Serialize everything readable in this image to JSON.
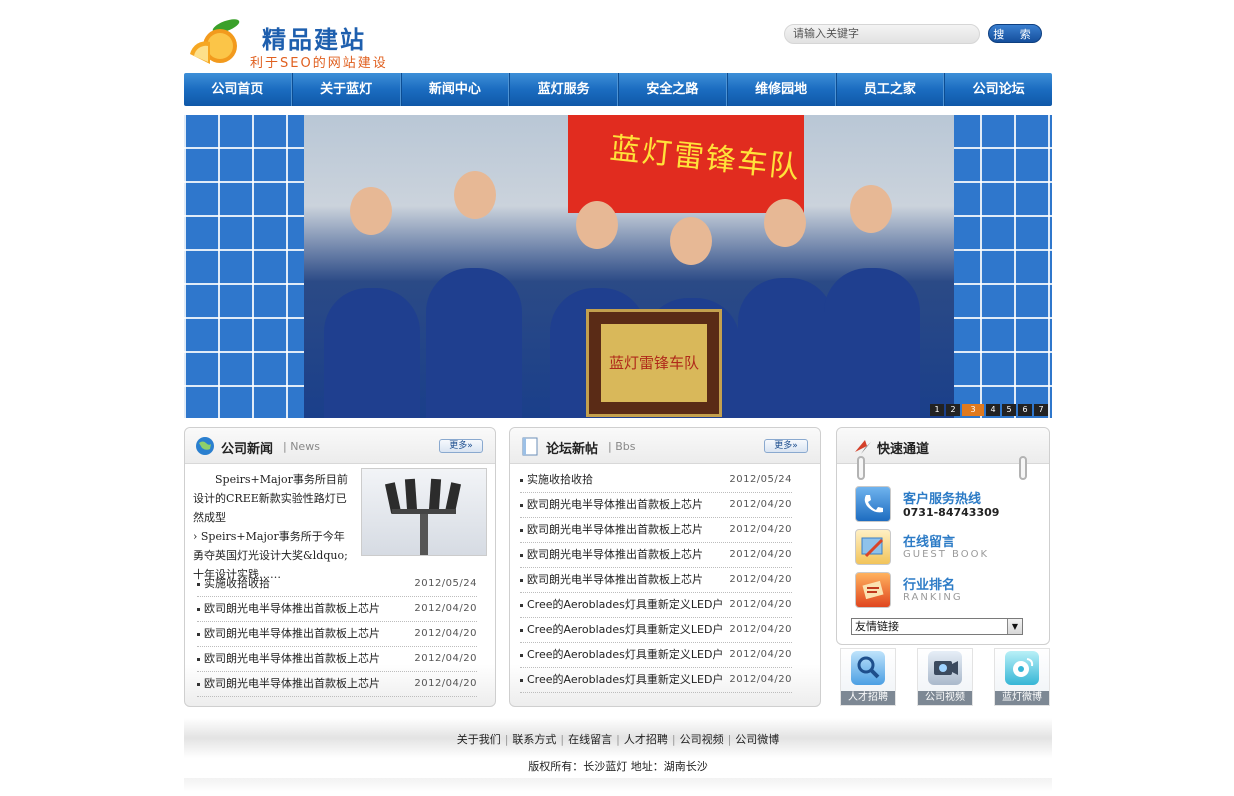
{
  "header": {
    "logo_title": "精品建站",
    "logo_subtitle": "利于SEO的网站建设",
    "search_placeholder": "请输入关键字",
    "search_button": "搜 索"
  },
  "nav": [
    "公司首页",
    "关于蓝灯",
    "新闻中心",
    "蓝灯服务",
    "安全之路",
    "维修园地",
    "员工之家",
    "公司论坛"
  ],
  "banner": {
    "flag_text": "蓝灯雷锋车队",
    "plaque_text": "蓝灯雷锋车队",
    "pages": [
      "1",
      "2",
      "3",
      "4",
      "5",
      "6",
      "7"
    ],
    "active_page": "3"
  },
  "news": {
    "title": "公司新闻",
    "subtitle": "| News",
    "more": "更多»",
    "intro_line1": "Speirs+Major事务所目前设计的CREE新款实验性路灯已然成型",
    "intro_line2": "› Speirs+Major事务所于今年勇夺英国灯光设计大奖&ldquo;十年设计实践……",
    "items": [
      {
        "title": "实施收拾收拾",
        "date": "2012/05/24"
      },
      {
        "title": "欧司朗光电半导体推出首款板上芯片",
        "date": "2012/04/20"
      },
      {
        "title": "欧司朗光电半导体推出首款板上芯片",
        "date": "2012/04/20"
      },
      {
        "title": "欧司朗光电半导体推出首款板上芯片",
        "date": "2012/04/20"
      },
      {
        "title": "欧司朗光电半导体推出首款板上芯片",
        "date": "2012/04/20"
      }
    ]
  },
  "bbs": {
    "title": "论坛新帖",
    "subtitle": "| Bbs",
    "more": "更多»",
    "items": [
      {
        "title": "实施收拾收拾",
        "date": "2012/05/24"
      },
      {
        "title": "欧司朗光电半导体推出首款板上芯片",
        "date": "2012/04/20"
      },
      {
        "title": "欧司朗光电半导体推出首款板上芯片",
        "date": "2012/04/20"
      },
      {
        "title": "欧司朗光电半导体推出首款板上芯片",
        "date": "2012/04/20"
      },
      {
        "title": "欧司朗光电半导体推出首款板上芯片",
        "date": "2012/04/20"
      },
      {
        "title": "Cree的Aeroblades灯具重新定义LED户",
        "date": "2012/04/20"
      },
      {
        "title": "Cree的Aeroblades灯具重新定义LED户",
        "date": "2012/04/20"
      },
      {
        "title": "Cree的Aeroblades灯具重新定义LED户",
        "date": "2012/04/20"
      },
      {
        "title": "Cree的Aeroblades灯具重新定义LED户",
        "date": "2012/04/20"
      }
    ]
  },
  "quick": {
    "title": "快速通道",
    "hotline_label": "客户服务热线",
    "hotline_number": "0731-84743309",
    "guestbook_label": "在线留言",
    "guestbook_en": "GUEST BOOK",
    "ranking_label": "行业排名",
    "ranking_en": "RANKING",
    "friend_links": "友情链接"
  },
  "tiles": [
    "人才招聘",
    "公司视频",
    "蓝灯微博"
  ],
  "footer": {
    "links": [
      "关于我们",
      "联系方式",
      "在线留言",
      "人才招聘",
      "公司视频",
      "公司微博"
    ],
    "copyright": "版权所有：长沙蓝灯 地址：湖南长沙"
  },
  "colors": {
    "nav_blue": "#1b6cc0",
    "link_blue": "#2c7bc6",
    "logo_orange": "#e06020",
    "flag_red": "#e12c1f",
    "active_page": "#e07a1f"
  }
}
